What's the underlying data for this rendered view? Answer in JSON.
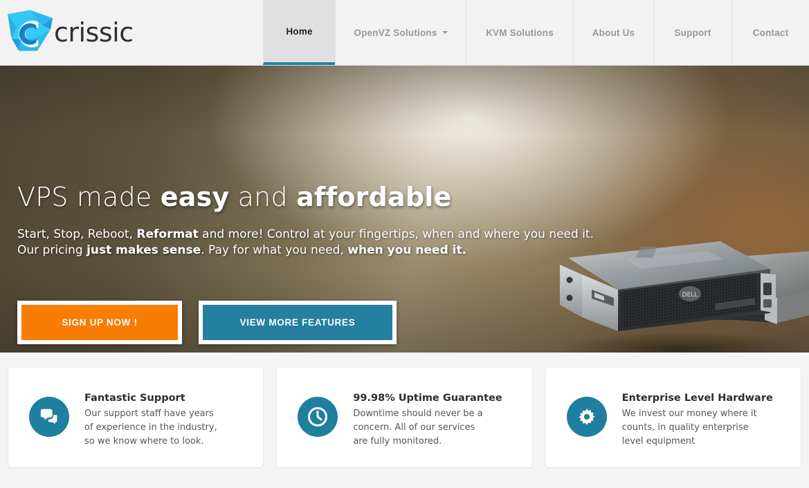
{
  "brand": {
    "name": "crissic",
    "logo_icon": "crissic-play-logo-icon",
    "logo_colors": [
      "#29c3f0",
      "#1a9fdc",
      "#0f7fc0",
      "#5dd8f7"
    ]
  },
  "nav": {
    "items": [
      {
        "label": "Home",
        "active": true,
        "has_dropdown": false,
        "name": "nav-item-home"
      },
      {
        "label": "OpenVZ Solutions",
        "active": false,
        "has_dropdown": true,
        "name": "nav-item-openvz-solutions"
      },
      {
        "label": "KVM Solutions",
        "active": false,
        "has_dropdown": false,
        "name": "nav-item-kvm-solutions"
      },
      {
        "label": "About Us",
        "active": false,
        "has_dropdown": false,
        "name": "nav-item-about-us"
      },
      {
        "label": "Support",
        "active": false,
        "has_dropdown": false,
        "name": "nav-item-support"
      },
      {
        "label": "Contact",
        "active": false,
        "has_dropdown": false,
        "name": "nav-item-contact"
      }
    ],
    "active_underline_color": "#2580a0"
  },
  "hero": {
    "title": {
      "part1": "VPS made ",
      "bold1": "easy",
      "part2": " and ",
      "bold2": "affordable"
    },
    "subtitle": {
      "line1_a": "Start, Stop, Reboot, ",
      "line1_b": "Reformat",
      "line1_c": " and more! Control at your fingertips, when and where you need it.",
      "line2_a": "Our pricing ",
      "line2_b": "just makes sense",
      "line2_c": ". Pay for what you need, ",
      "line2_d": "when you need it."
    },
    "buttons": {
      "primary_label": "SIGN UP NOW !",
      "primary_color": "#f97c05",
      "secondary_label": "VIEW MORE FEATURES",
      "secondary_color": "#2580a0"
    },
    "slider": {
      "total": 3,
      "active_index": 1,
      "active_color": "#000000",
      "inactive_color": "#d2d2d2"
    },
    "image_alt": "dell-rack-servers-image"
  },
  "features": {
    "cards": [
      {
        "icon": "chat-bubbles-icon",
        "title": "Fantastic Support",
        "text": "Our support staff have years of experience in the industry, so we know where to look."
      },
      {
        "icon": "clock-icon",
        "title": "99.98% Uptime Guarantee",
        "text": "Downtime should never be a concern. All of our services are fully monitored."
      },
      {
        "icon": "gear-icon",
        "title": "Enterprise Level Hardware",
        "text": "We invest our money where it counts, in quality enterprise level equipment"
      }
    ],
    "icon_color": "#1f7f9e"
  }
}
